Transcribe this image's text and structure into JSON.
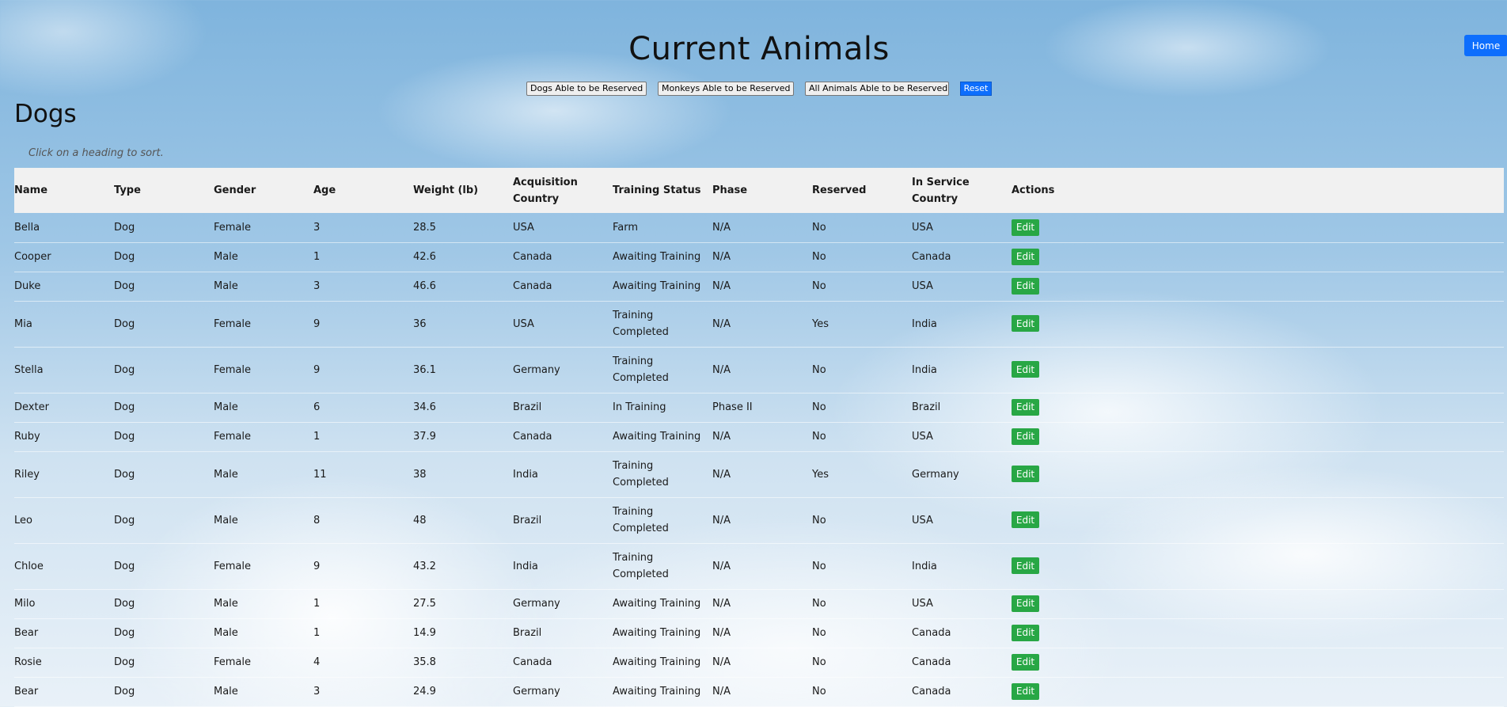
{
  "page": {
    "title": "Current Animals",
    "home_label": "Home"
  },
  "filters": {
    "dogs": "Dogs Able to be Reserved",
    "monkeys": "Monkeys Able to be Reserved",
    "all": "All Animals Able to be Reserved",
    "reset": "Reset"
  },
  "section": {
    "title": "Dogs",
    "hint": "Click on a heading to sort."
  },
  "table": {
    "headers": [
      "Name",
      "Type",
      "Gender",
      "Age",
      "Weight (lb)",
      "Acquisition Country",
      "Training Status",
      "Phase",
      "Reserved",
      "In Service Country",
      "Actions"
    ],
    "edit_label": "Edit",
    "rows": [
      [
        "Bella",
        "Dog",
        "Female",
        "3",
        "28.5",
        "USA",
        "Farm",
        "N/A",
        "No",
        "USA"
      ],
      [
        "Cooper",
        "Dog",
        "Male",
        "1",
        "42.6",
        "Canada",
        "Awaiting Training",
        "N/A",
        "No",
        "Canada"
      ],
      [
        "Duke",
        "Dog",
        "Male",
        "3",
        "46.6",
        "Canada",
        "Awaiting Training",
        "N/A",
        "No",
        "USA"
      ],
      [
        "Mia",
        "Dog",
        "Female",
        "9",
        "36",
        "USA",
        "Training Completed",
        "N/A",
        "Yes",
        "India"
      ],
      [
        "Stella",
        "Dog",
        "Female",
        "9",
        "36.1",
        "Germany",
        "Training Completed",
        "N/A",
        "No",
        "India"
      ],
      [
        "Dexter",
        "Dog",
        "Male",
        "6",
        "34.6",
        "Brazil",
        "In Training",
        "Phase II",
        "No",
        "Brazil"
      ],
      [
        "Ruby",
        "Dog",
        "Female",
        "1",
        "37.9",
        "Canada",
        "Awaiting Training",
        "N/A",
        "No",
        "USA"
      ],
      [
        "Riley",
        "Dog",
        "Male",
        "11",
        "38",
        "India",
        "Training Completed",
        "N/A",
        "Yes",
        "Germany"
      ],
      [
        "Leo",
        "Dog",
        "Male",
        "8",
        "48",
        "Brazil",
        "Training Completed",
        "N/A",
        "No",
        "USA"
      ],
      [
        "Chloe",
        "Dog",
        "Female",
        "9",
        "43.2",
        "India",
        "Training Completed",
        "N/A",
        "No",
        "India"
      ],
      [
        "Milo",
        "Dog",
        "Male",
        "1",
        "27.5",
        "Germany",
        "Awaiting Training",
        "N/A",
        "No",
        "USA"
      ],
      [
        "Bear",
        "Dog",
        "Male",
        "1",
        "14.9",
        "Brazil",
        "Awaiting Training",
        "N/A",
        "No",
        "Canada"
      ],
      [
        "Rosie",
        "Dog",
        "Female",
        "4",
        "35.8",
        "Canada",
        "Awaiting Training",
        "N/A",
        "No",
        "Canada"
      ],
      [
        "Bear",
        "Dog",
        "Male",
        "3",
        "24.9",
        "Germany",
        "Awaiting Training",
        "N/A",
        "No",
        "Canada"
      ]
    ]
  }
}
